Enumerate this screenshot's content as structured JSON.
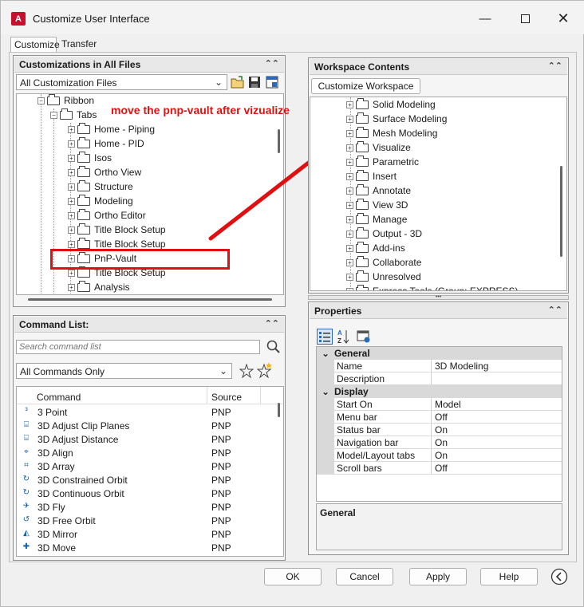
{
  "window": {
    "title": "Customize User Interface"
  },
  "tabs": [
    "Customize",
    "Transfer"
  ],
  "customizations": {
    "title": "Customizations in All Files",
    "file_filter": "All Customization Files",
    "tree": [
      {
        "label": "Ribbon",
        "level": 0
      },
      {
        "label": "Tabs",
        "level": 1
      },
      {
        "label": "Home - Piping",
        "level": 2
      },
      {
        "label": "Home - PID",
        "level": 2
      },
      {
        "label": "Isos",
        "level": 2
      },
      {
        "label": "Ortho View",
        "level": 2
      },
      {
        "label": "Structure",
        "level": 2
      },
      {
        "label": "Modeling",
        "level": 2
      },
      {
        "label": "Ortho Editor",
        "level": 2
      },
      {
        "label": "Title Block Setup",
        "level": 2
      },
      {
        "label": "Title Block Setup",
        "level": 2
      },
      {
        "label": "PnP-Vault",
        "level": 2
      },
      {
        "label": "Title Block Setup",
        "level": 2
      },
      {
        "label": "Analysis",
        "level": 2
      }
    ]
  },
  "annotation": {
    "text": "move the pnp-vault after vizualize",
    "color": "#e01010"
  },
  "command_list": {
    "title": "Command List:",
    "search_placeholder": "Search command list",
    "filter": "All Commands Only",
    "col_command": "Command",
    "col_source": "Source",
    "rows": [
      {
        "name": "3 Point",
        "source": "PNP"
      },
      {
        "name": "3D Adjust Clip Planes",
        "source": "PNP"
      },
      {
        "name": "3D Adjust Distance",
        "source": "PNP"
      },
      {
        "name": "3D Align",
        "source": "PNP"
      },
      {
        "name": "3D Array",
        "source": "PNP"
      },
      {
        "name": "3D Constrained Orbit",
        "source": "PNP"
      },
      {
        "name": "3D Continuous Orbit",
        "source": "PNP"
      },
      {
        "name": "3D Fly",
        "source": "PNP"
      },
      {
        "name": "3D Free Orbit",
        "source": "PNP"
      },
      {
        "name": "3D Mirror",
        "source": "PNP"
      },
      {
        "name": "3D Move",
        "source": "PNP"
      }
    ]
  },
  "workspace": {
    "title": "Workspace Contents",
    "customize_button": "Customize Workspace",
    "tree": [
      "Solid Modeling",
      "Surface Modeling",
      "Mesh Modeling",
      "Visualize",
      "Parametric",
      "Insert",
      "Annotate",
      "View 3D",
      "Manage",
      "Output - 3D",
      "Add-ins",
      "Collaborate",
      "Unresolved",
      "Express Tools (Group: EXPRESS)"
    ]
  },
  "properties": {
    "title": "Properties",
    "categories": [
      {
        "name": "General",
        "rows": [
          {
            "name": "Name",
            "value": "3D Modeling"
          },
          {
            "name": "Description",
            "value": ""
          }
        ]
      },
      {
        "name": "Display",
        "rows": [
          {
            "name": "Start On",
            "value": "Model"
          },
          {
            "name": "Menu bar",
            "value": "Off"
          },
          {
            "name": "Status bar",
            "value": "On"
          },
          {
            "name": "Navigation bar",
            "value": "On"
          },
          {
            "name": "Model/Layout tabs",
            "value": "On"
          },
          {
            "name": "Scroll bars",
            "value": "Off"
          }
        ]
      }
    ],
    "description_title": "General"
  },
  "buttons": {
    "ok": "OK",
    "cancel": "Cancel",
    "apply": "Apply",
    "help": "Help"
  }
}
